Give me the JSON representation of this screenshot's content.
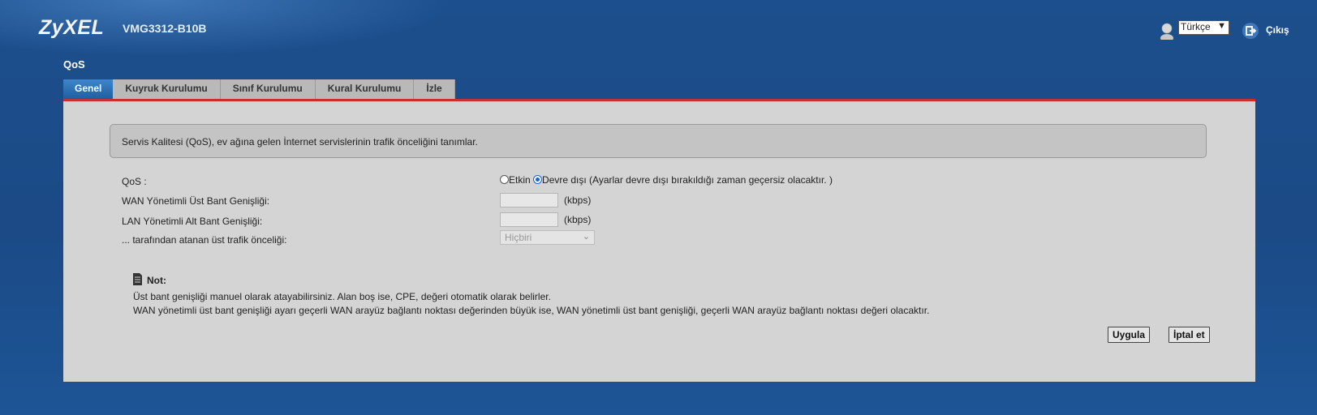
{
  "header": {
    "brand": "ZyXEL",
    "model": "VMG3312-B10B",
    "language": "Türkçe",
    "logout_label": "Çıkış"
  },
  "page": {
    "title": "QoS",
    "tabs": [
      {
        "label": "Genel",
        "active": true
      },
      {
        "label": "Kuyruk Kurulumu",
        "active": false
      },
      {
        "label": "Sınıf Kurulumu",
        "active": false
      },
      {
        "label": "Kural Kurulumu",
        "active": false
      },
      {
        "label": "İzle",
        "active": false
      }
    ]
  },
  "content": {
    "description": "Servis Kalitesi (QoS), ev ağına gelen İnternet servislerinin trafik önceliğini tanımlar.",
    "qos": {
      "label": "QoS :",
      "option_enabled": "Etkin",
      "option_disabled": "Devre dışı (Ayarlar devre dışı bırakıldığı zaman geçersiz olacaktır. )",
      "selected": "Devre dışı"
    },
    "wan_upstream": {
      "label": "WAN Yönetimli Üst Bant Genişliği:",
      "value": "",
      "unit": "(kbps)"
    },
    "lan_downstream": {
      "label": "LAN Yönetimli Alt Bant Genişliği:",
      "value": "",
      "unit": "(kbps)"
    },
    "priority": {
      "label": "... tarafından atanan üst trafik önceliği:",
      "value": "Hiçbiri"
    },
    "note": {
      "title": "Not:",
      "lines": [
        "Üst bant genişliği manuel olarak atayabilirsiniz. Alan boş ise, CPE, değeri otomatik olarak belirler.",
        "WAN yönetimli üst bant genişliği ayarı geçerli WAN arayüz bağlantı noktası değerinden büyük ise, WAN yönetimli üst bant genişliği, geçerli WAN arayüz bağlantı noktası değeri olacaktır."
      ]
    },
    "buttons": {
      "apply": "Uygula",
      "cancel": "İptal et"
    }
  }
}
